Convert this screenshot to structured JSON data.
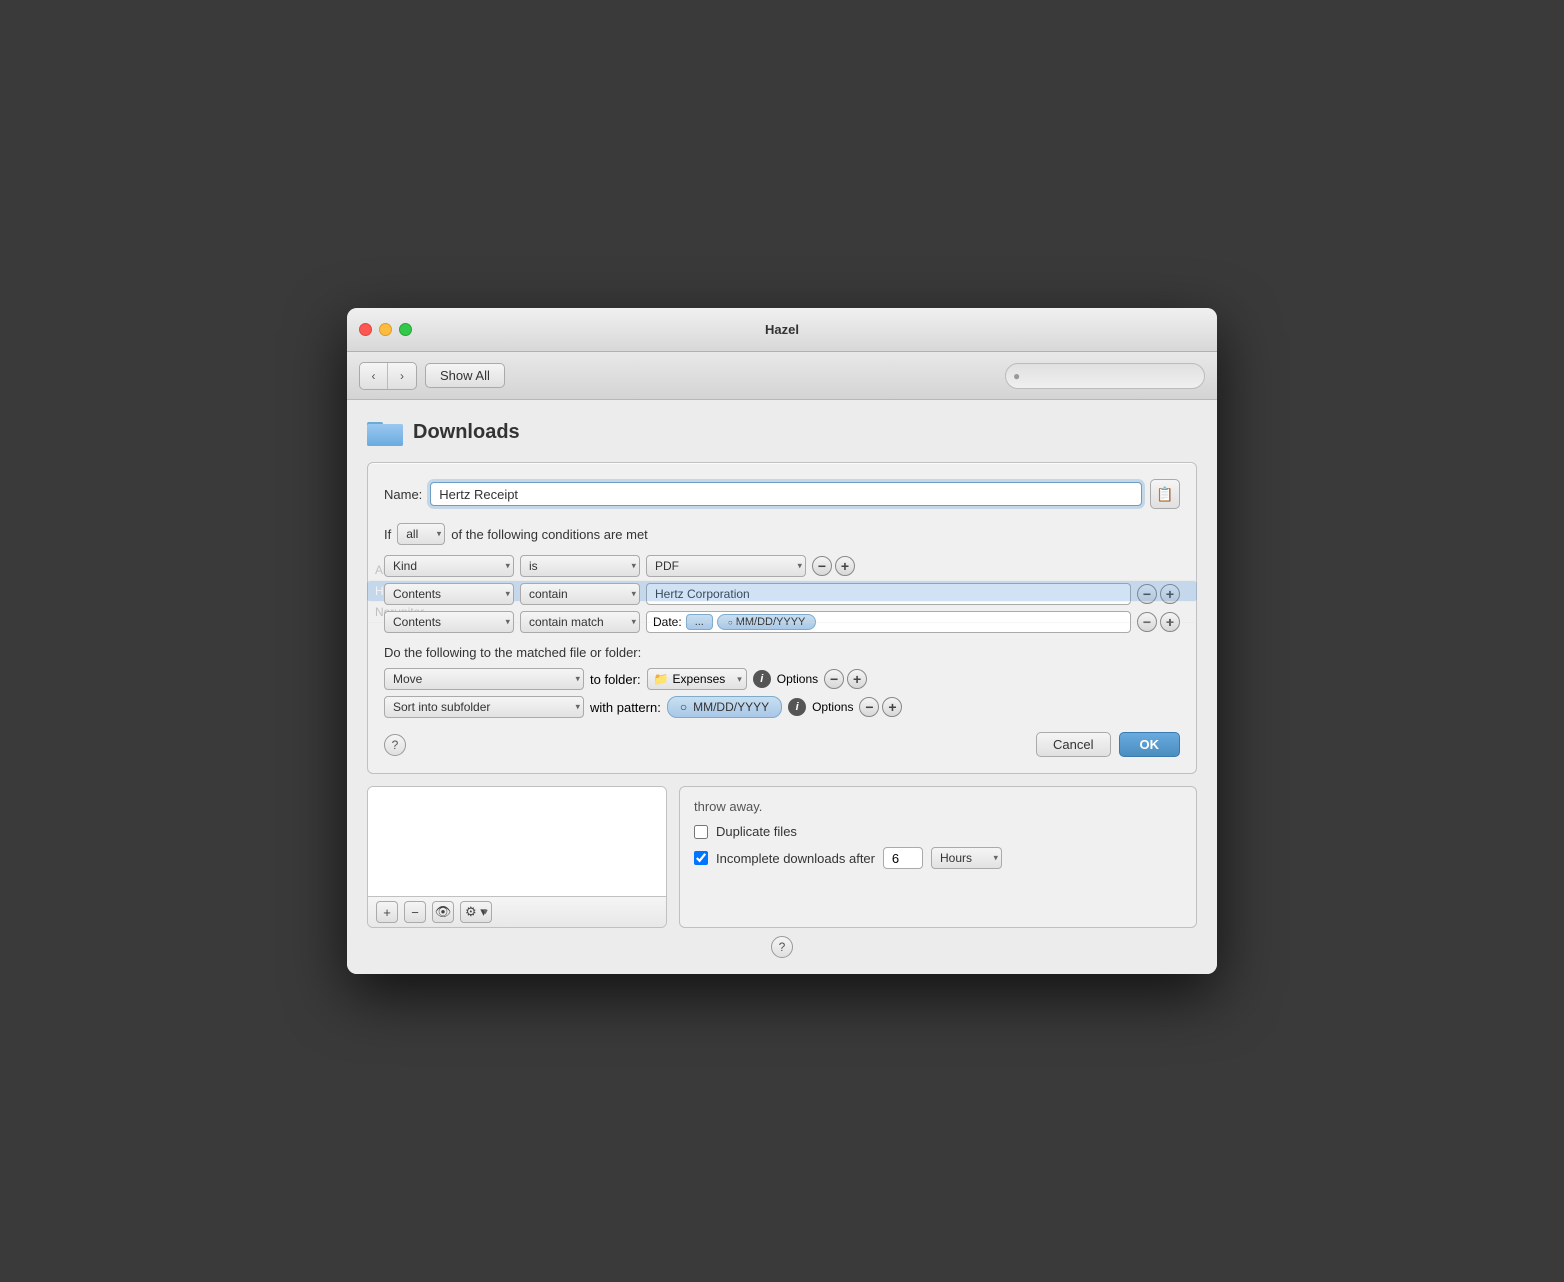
{
  "window": {
    "title": "Hazel"
  },
  "toolbar": {
    "show_all_label": "Show All",
    "search_placeholder": ""
  },
  "section": {
    "title": "Downloads"
  },
  "name_row": {
    "label": "Name:",
    "value": "Hertz Receipt"
  },
  "conditions": {
    "if_label": "If",
    "all_option": "all",
    "of_following_label": "of the following conditions are met",
    "rows": [
      {
        "field": "Kind",
        "operator": "is",
        "value": "PDF"
      },
      {
        "field": "Contents",
        "operator": "contain",
        "value": "Hertz Corporation"
      },
      {
        "field": "Contents",
        "operator": "contain match",
        "value": "Date:"
      }
    ]
  },
  "actions": {
    "label": "Do the following to the matched file or folder:",
    "rows": [
      {
        "action": "Move",
        "to_folder_label": "to folder:",
        "folder": "Expenses",
        "options_label": "Options"
      },
      {
        "action": "Sort into subfolder",
        "with_pattern_label": "with pattern:",
        "pattern": "○ MM/DD/YYYY",
        "options_label": "Options"
      }
    ]
  },
  "buttons": {
    "cancel": "Cancel",
    "ok": "OK"
  },
  "lower": {
    "throw_away_text": "throw away.",
    "duplicate_files_label": "Duplicate files",
    "incomplete_label": "Incomplete downloads after",
    "incomplete_value": "6",
    "hours_option": "Hours"
  },
  "bg_rules": [
    {
      "label": "Airport Parking Receipt"
    },
    {
      "label": "Hertz Receipt",
      "selected": true
    },
    {
      "label": "Norupiter"
    }
  ]
}
